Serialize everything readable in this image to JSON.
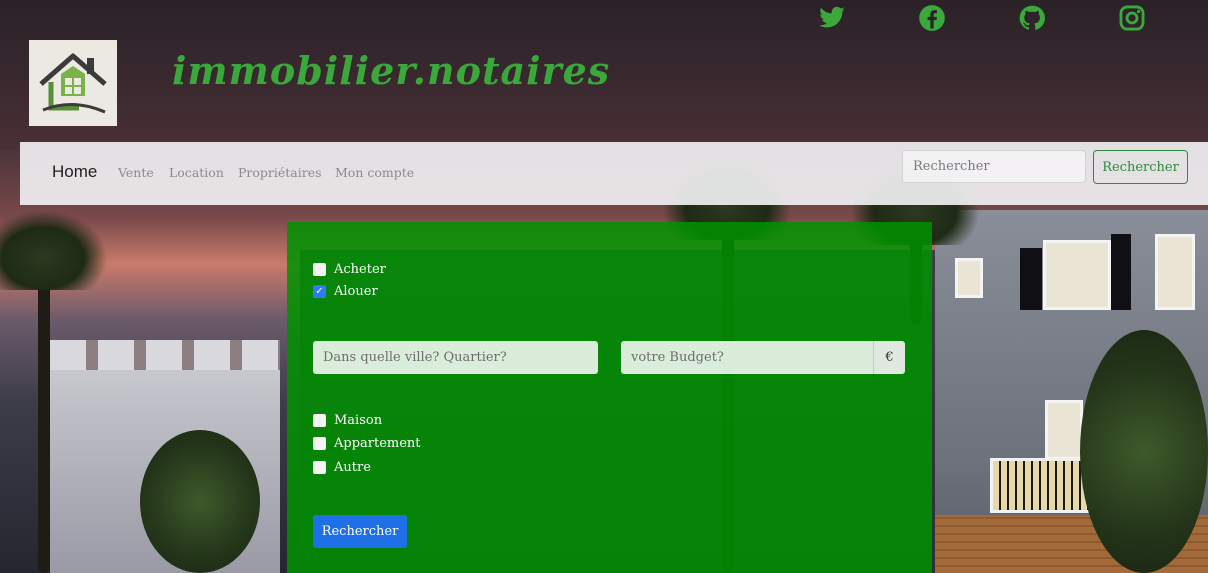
{
  "header": {
    "brand": "immobilier.notaires",
    "logo_icon": "house-logo-icon",
    "social": [
      {
        "icon": "twitter-icon"
      },
      {
        "icon": "facebook-icon"
      },
      {
        "icon": "github-icon"
      },
      {
        "icon": "instagram-icon"
      }
    ],
    "social_color": "#3aa83a"
  },
  "navbar": {
    "home": "Home",
    "links": [
      "Vente",
      "Location",
      "Propriétaires",
      "Mon compte"
    ],
    "search_placeholder": "Rechercher",
    "search_button": "Rechercher"
  },
  "search_panel": {
    "background": "#009100",
    "transaction": [
      {
        "label": "Acheter",
        "checked": false
      },
      {
        "label": "Alouer",
        "checked": true
      }
    ],
    "city_placeholder": "Dans quelle ville? Quartier?",
    "budget_placeholder": "votre Budget?",
    "budget_currency": "€",
    "property_types": [
      {
        "label": "Maison",
        "checked": false
      },
      {
        "label": "Appartement",
        "checked": false
      },
      {
        "label": "Autre",
        "checked": false
      }
    ],
    "submit_label": "Rechercher",
    "submit_color": "#1f6fe6"
  }
}
